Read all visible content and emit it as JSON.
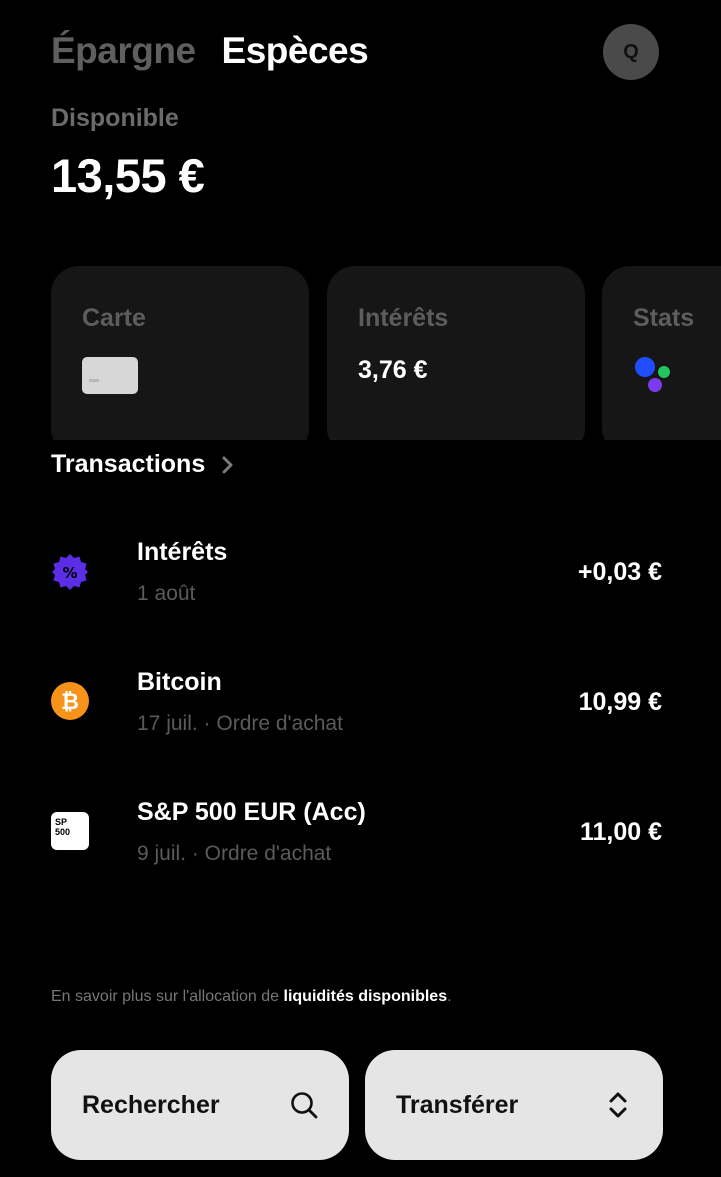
{
  "header": {
    "tab_savings": "Épargne",
    "tab_cash": "Espèces",
    "avatar_initial": "Q"
  },
  "balance": {
    "label": "Disponible",
    "amount": "13,55 €"
  },
  "cards": {
    "card": {
      "title": "Carte",
      "icon": "card-icon"
    },
    "interest": {
      "title": "Intérêts",
      "value": "3,76 €"
    },
    "stats": {
      "title": "Stats",
      "icon": "stats-dots-icon"
    }
  },
  "transactions": {
    "heading": "Transactions",
    "items": [
      {
        "title": "Intérêts",
        "subtitle": "1 août",
        "amount": "+0,03 €",
        "icon": "percent-badge-icon"
      },
      {
        "title": "Bitcoin",
        "subtitle": "17 juil. · Ordre d'achat",
        "amount": "10,99 €",
        "icon": "bitcoin-icon"
      },
      {
        "title": "S&P 500 EUR (Acc)",
        "subtitle": "9 juil. · Ordre d'achat",
        "amount": "11,00 €",
        "icon": "sp500-icon",
        "icon_text_1": "SP",
        "icon_text_2": "500"
      }
    ]
  },
  "info": {
    "prefix": "En savoir plus sur l'allocation de ",
    "link": "liquidités disponibles",
    "suffix": "."
  },
  "actions": {
    "search_label": "Rechercher",
    "transfer_label": "Transférer"
  },
  "colors": {
    "background": "#000000",
    "card_bg": "#161616",
    "muted_text": "#5f5f5f",
    "button_bg": "#e5e5e5",
    "percent_purple": "#5b2ee6",
    "bitcoin_orange": "#f7931a"
  }
}
